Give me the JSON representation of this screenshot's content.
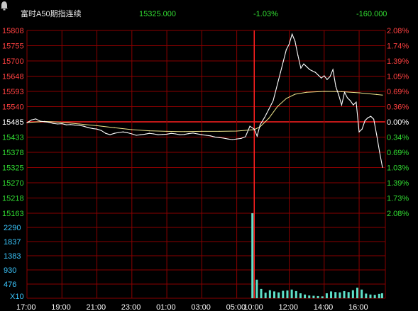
{
  "header": {
    "title": "富时A50期指连续",
    "bell_icon": "bell-icon",
    "last_price": "15325.000",
    "change_pct": "-1.03%",
    "change": "-160.000"
  },
  "colors": {
    "background": "#000000",
    "grid": "#8a0000",
    "baseline": "#ff2020",
    "up": "#ff4040",
    "down": "#32dc32",
    "neutral": "#ffffff",
    "price_line": "#ffffff",
    "avg_line": "#f0e68c",
    "volume": "#5fe0c8",
    "volume_label": "#3cc8ff",
    "time_label": "#ffffff"
  },
  "chart_data": {
    "type": "line",
    "baseline_price": 15485,
    "price_ylim": [
      15163,
      15808
    ],
    "price_ticks_left": [
      "15808",
      "15755",
      "15700",
      "15648",
      "15593",
      "15540",
      "15485",
      "15433",
      "15378",
      "15325",
      "15270",
      "15218",
      "15163"
    ],
    "price_ticks_right": [
      "2.08%",
      "1.74%",
      "1.39%",
      "1.05%",
      "0.69%",
      "0.36%",
      "0.00%",
      "0.34%",
      "0.69%",
      "1.03%",
      "1.39%",
      "1.73%",
      "2.08%"
    ],
    "volume_ticks": [
      "2290",
      "1837",
      "1383",
      "930",
      "476"
    ],
    "volume_unit": "X10",
    "volume_ylim": [
      0,
      2743
    ],
    "time_ticks": [
      "17:00",
      "19:00",
      "21:00",
      "23:00",
      "01:00",
      "03:00",
      "05:00",
      "10:00",
      "12:00",
      "14:00",
      "16:00"
    ],
    "time_tick_minutes": [
      0,
      120,
      240,
      360,
      480,
      600,
      720,
      780,
      900,
      1020,
      1140
    ],
    "session_total_minutes": 1230,
    "session_break_minute": 780,
    "series": [
      {
        "kind": "price",
        "points": [
          [
            0,
            15482
          ],
          [
            15,
            15492
          ],
          [
            30,
            15496
          ],
          [
            45,
            15488
          ],
          [
            60,
            15486
          ],
          [
            75,
            15484
          ],
          [
            90,
            15480
          ],
          [
            105,
            15478
          ],
          [
            120,
            15479
          ],
          [
            135,
            15475
          ],
          [
            150,
            15476
          ],
          [
            165,
            15474
          ],
          [
            180,
            15473
          ],
          [
            195,
            15470
          ],
          [
            210,
            15465
          ],
          [
            225,
            15462
          ],
          [
            240,
            15460
          ],
          [
            255,
            15455
          ],
          [
            270,
            15445
          ],
          [
            285,
            15440
          ],
          [
            300,
            15445
          ],
          [
            315,
            15448
          ],
          [
            330,
            15450
          ],
          [
            345,
            15447
          ],
          [
            360,
            15443
          ],
          [
            375,
            15438
          ],
          [
            390,
            15440
          ],
          [
            405,
            15442
          ],
          [
            420,
            15445
          ],
          [
            435,
            15443
          ],
          [
            450,
            15440
          ],
          [
            465,
            15441
          ],
          [
            480,
            15442
          ],
          [
            495,
            15445
          ],
          [
            510,
            15443
          ],
          [
            525,
            15440
          ],
          [
            540,
            15441
          ],
          [
            555,
            15444
          ],
          [
            570,
            15446
          ],
          [
            585,
            15443
          ],
          [
            600,
            15440
          ],
          [
            615,
            15438
          ],
          [
            630,
            15436
          ],
          [
            645,
            15432
          ],
          [
            660,
            15430
          ],
          [
            675,
            15428
          ],
          [
            690,
            15425
          ],
          [
            705,
            15423
          ],
          [
            720,
            15425
          ],
          [
            735,
            15427
          ],
          [
            750,
            15433
          ],
          [
            765,
            15470
          ],
          [
            780,
            15460
          ],
          [
            790,
            15435
          ],
          [
            800,
            15475
          ],
          [
            815,
            15500
          ],
          [
            830,
            15530
          ],
          [
            845,
            15560
          ],
          [
            860,
            15620
          ],
          [
            870,
            15660
          ],
          [
            880,
            15700
          ],
          [
            890,
            15740
          ],
          [
            900,
            15760
          ],
          [
            910,
            15795
          ],
          [
            920,
            15770
          ],
          [
            930,
            15720
          ],
          [
            940,
            15675
          ],
          [
            950,
            15690
          ],
          [
            960,
            15680
          ],
          [
            970,
            15670
          ],
          [
            980,
            15665
          ],
          [
            990,
            15660
          ],
          [
            1000,
            15650
          ],
          [
            1010,
            15640
          ],
          [
            1020,
            15648
          ],
          [
            1030,
            15635
          ],
          [
            1040,
            15645
          ],
          [
            1050,
            15670
          ],
          [
            1060,
            15610
          ],
          [
            1070,
            15580
          ],
          [
            1080,
            15545
          ],
          [
            1090,
            15590
          ],
          [
            1100,
            15570
          ],
          [
            1110,
            15560
          ],
          [
            1120,
            15545
          ],
          [
            1130,
            15555
          ],
          [
            1140,
            15450
          ],
          [
            1150,
            15460
          ],
          [
            1160,
            15490
          ],
          [
            1170,
            15500
          ],
          [
            1180,
            15505
          ],
          [
            1190,
            15495
          ],
          [
            1200,
            15440
          ],
          [
            1210,
            15380
          ],
          [
            1220,
            15325
          ]
        ]
      },
      {
        "kind": "average",
        "points": [
          [
            0,
            15483
          ],
          [
            60,
            15487
          ],
          [
            120,
            15484
          ],
          [
            180,
            15478
          ],
          [
            240,
            15472
          ],
          [
            300,
            15465
          ],
          [
            360,
            15458
          ],
          [
            420,
            15454
          ],
          [
            480,
            15452
          ],
          [
            540,
            15451
          ],
          [
            600,
            15452
          ],
          [
            660,
            15452
          ],
          [
            720,
            15453
          ],
          [
            780,
            15458
          ],
          [
            800,
            15468
          ],
          [
            830,
            15498
          ],
          [
            860,
            15540
          ],
          [
            890,
            15568
          ],
          [
            920,
            15583
          ],
          [
            960,
            15590
          ],
          [
            1020,
            15593
          ],
          [
            1080,
            15592
          ],
          [
            1140,
            15588
          ],
          [
            1200,
            15582
          ],
          [
            1220,
            15580
          ]
        ]
      },
      {
        "kind": "volume",
        "points": [
          [
            775,
            2743
          ],
          [
            790,
            600
          ],
          [
            805,
            300
          ],
          [
            820,
            180
          ],
          [
            835,
            260
          ],
          [
            850,
            220
          ],
          [
            865,
            190
          ],
          [
            880,
            240
          ],
          [
            895,
            250
          ],
          [
            910,
            280
          ],
          [
            925,
            230
          ],
          [
            940,
            160
          ],
          [
            955,
            120
          ],
          [
            970,
            90
          ],
          [
            985,
            80
          ],
          [
            1000,
            70
          ],
          [
            1015,
            60
          ],
          [
            1030,
            160
          ],
          [
            1045,
            220
          ],
          [
            1060,
            200
          ],
          [
            1075,
            190
          ],
          [
            1090,
            230
          ],
          [
            1105,
            200
          ],
          [
            1120,
            260
          ],
          [
            1135,
            340
          ],
          [
            1150,
            280
          ],
          [
            1165,
            150
          ],
          [
            1180,
            120
          ],
          [
            1195,
            110
          ],
          [
            1210,
            140
          ],
          [
            1220,
            160
          ]
        ]
      }
    ]
  }
}
